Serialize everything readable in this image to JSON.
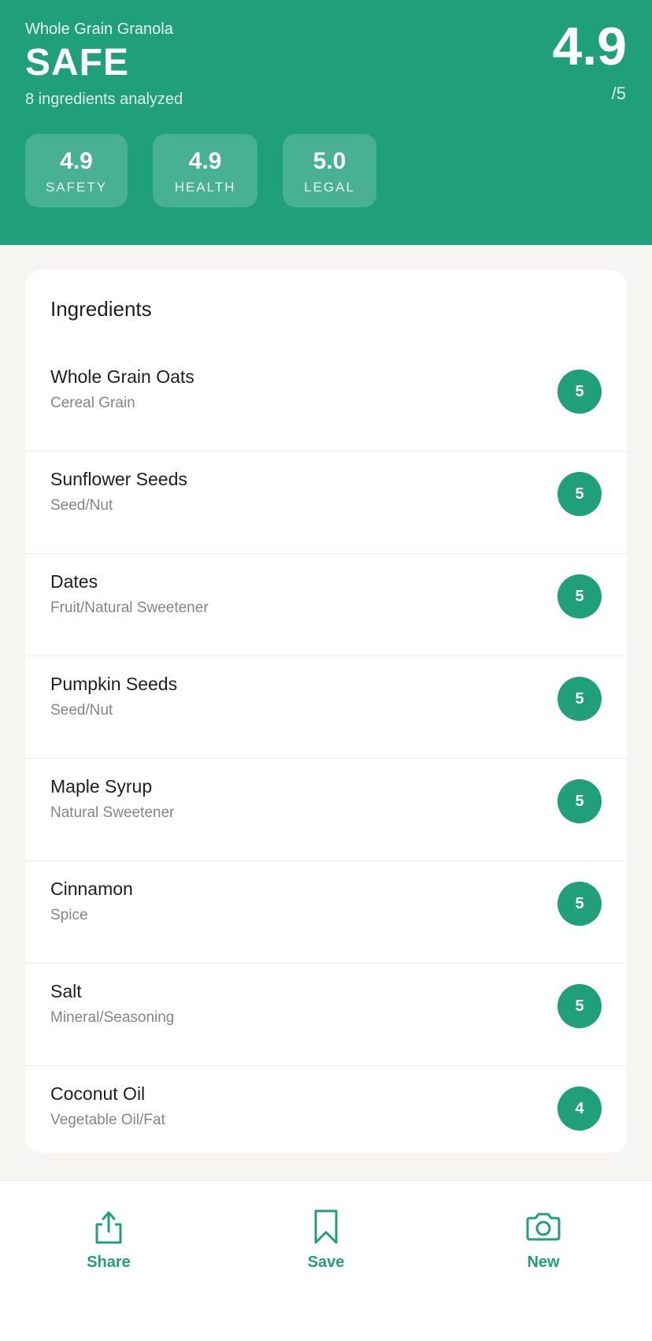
{
  "header": {
    "product_name": "Whole Grain Granola",
    "verdict": "SAFE",
    "analyzed": "8 ingredients analyzed",
    "overall_score": "4.9",
    "overall_max": "/5",
    "background_color": "#20a07a"
  },
  "score_chips": [
    {
      "value": "4.9",
      "label": "SAFETY"
    },
    {
      "value": "4.9",
      "label": "HEALTH"
    },
    {
      "value": "5.0",
      "label": "LEGAL"
    }
  ],
  "ingredients_card": {
    "title": "Ingredients",
    "items": [
      {
        "name": "Whole Grain Oats",
        "category": "Cereal Grain",
        "score": "5"
      },
      {
        "name": "Sunflower Seeds",
        "category": "Seed/Nut",
        "score": "5"
      },
      {
        "name": "Dates",
        "category": "Fruit/Natural Sweetener",
        "score": "5"
      },
      {
        "name": "Pumpkin Seeds",
        "category": "Seed/Nut",
        "score": "5"
      },
      {
        "name": "Maple Syrup",
        "category": "Natural Sweetener",
        "score": "5"
      },
      {
        "name": "Cinnamon",
        "category": "Spice",
        "score": "5"
      },
      {
        "name": "Salt",
        "category": "Mineral/Seasoning",
        "score": "5"
      },
      {
        "name": "Coconut Oil",
        "category": "Vegetable Oil/Fat",
        "score": "4"
      }
    ]
  },
  "bottom_nav": [
    {
      "label": "Share",
      "icon": "share-icon"
    },
    {
      "label": "Save",
      "icon": "bookmark-icon"
    },
    {
      "label": "New",
      "icon": "camera-icon"
    }
  ],
  "colors": {
    "accent": "#20a07a",
    "background": "#f6f5f2"
  }
}
